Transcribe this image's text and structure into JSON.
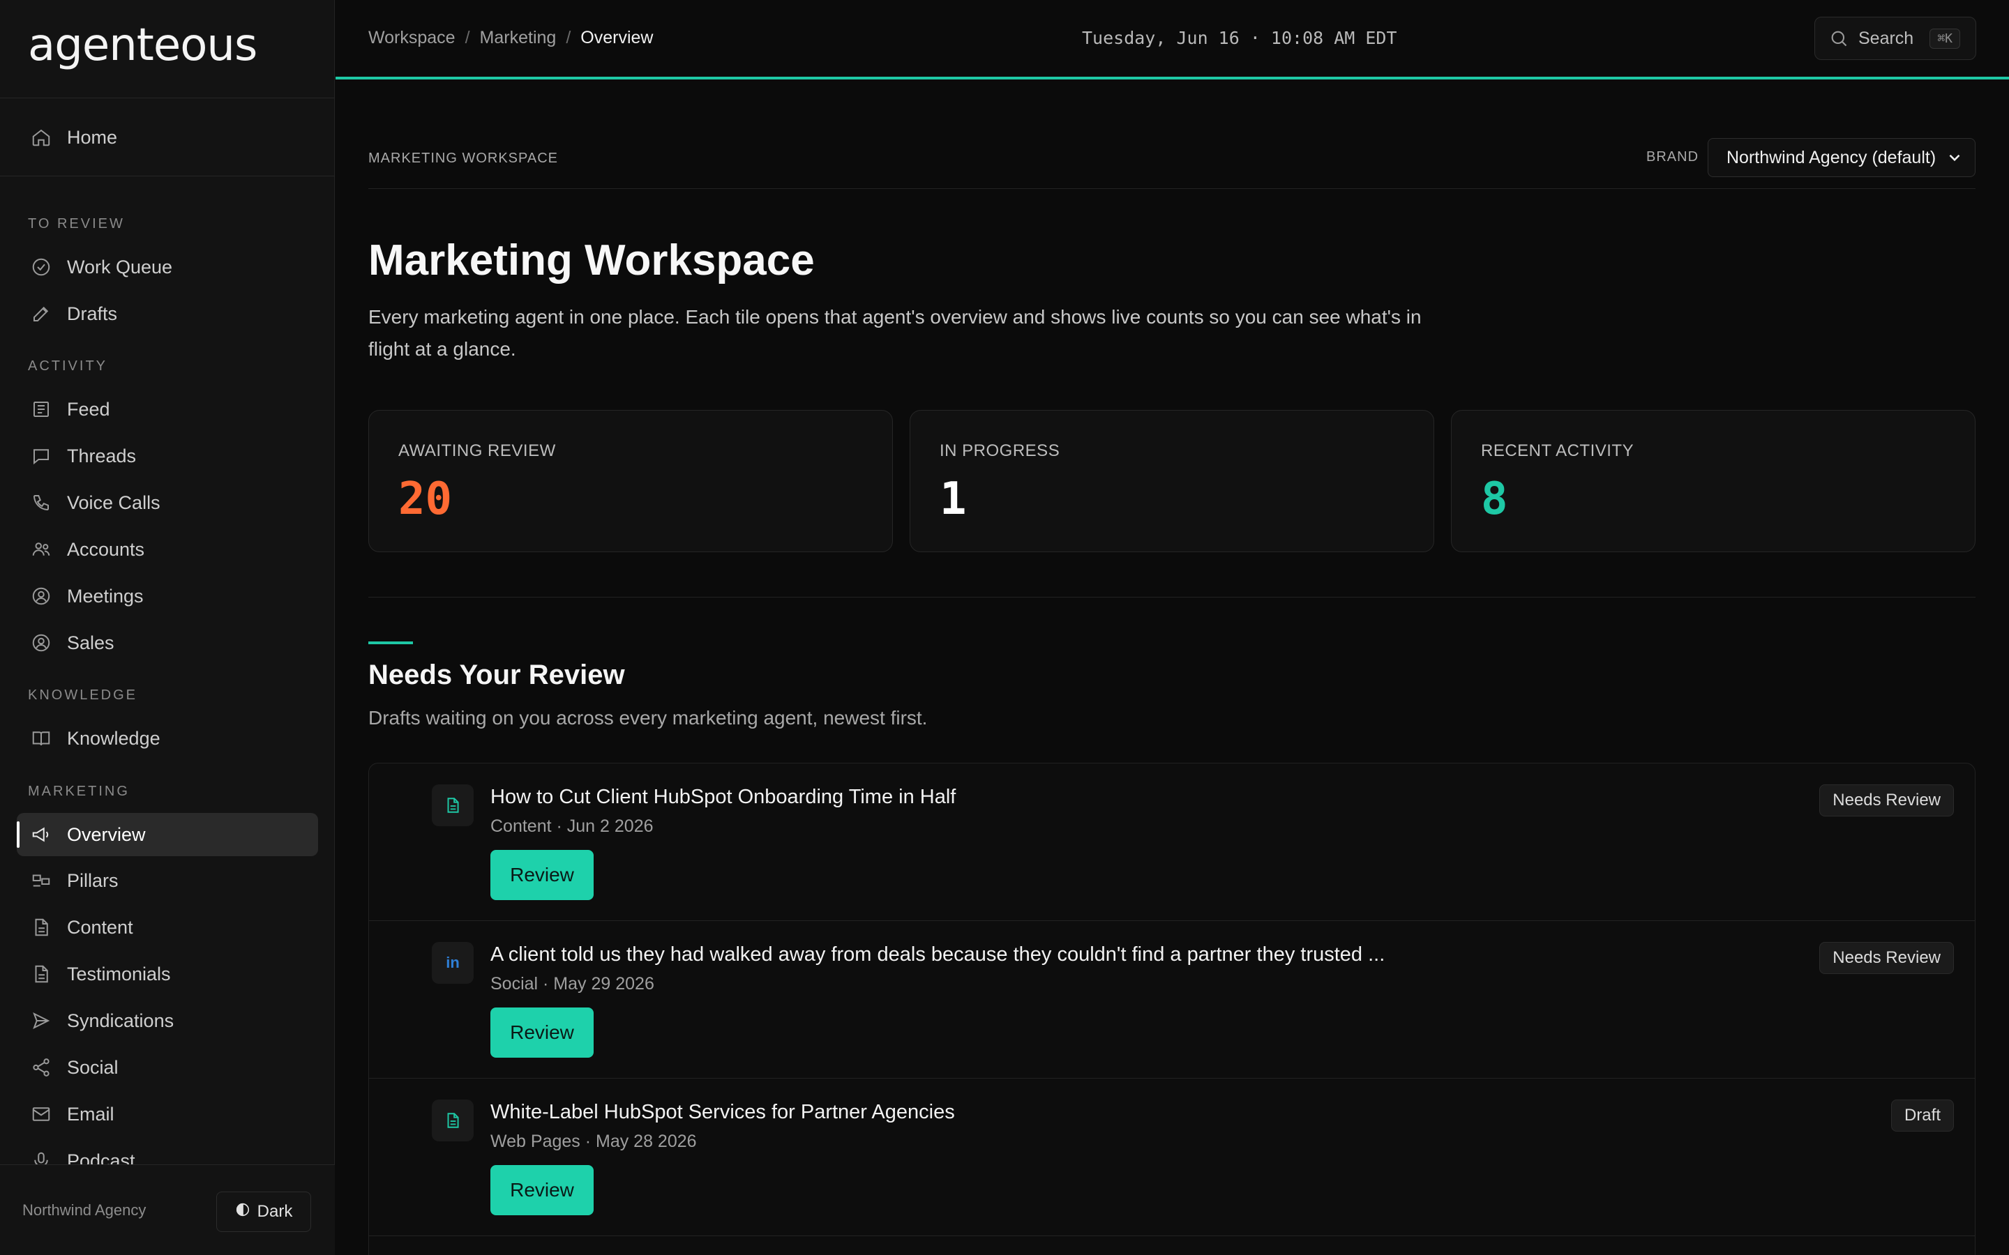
{
  "app": {
    "logo_text": "agenteous"
  },
  "sidebar": {
    "home": "Home",
    "sections": {
      "to_review": "TO REVIEW",
      "activity": "ACTIVITY",
      "knowledge": "KNOWLEDGE",
      "marketing": "MARKETING"
    },
    "to_review_items": [
      "Work Queue",
      "Drafts"
    ],
    "activity_items": [
      "Feed",
      "Threads",
      "Voice Calls",
      "Accounts",
      "Meetings",
      "Sales"
    ],
    "knowledge_items": [
      "Knowledge"
    ],
    "marketing_items": [
      "Overview",
      "Pillars",
      "Content",
      "Testimonials",
      "Syndications",
      "Social",
      "Email",
      "Podcast"
    ],
    "active_item": "Overview",
    "footer_org": "Northwind Agency",
    "theme_label": "Dark"
  },
  "topbar": {
    "breadcrumb": [
      "Workspace",
      "Marketing",
      "Overview"
    ],
    "datetime": "Tuesday, Jun 16 · 10:08 AM EDT",
    "search_label": "Search",
    "search_shortcut": "⌘K",
    "accent_color": "#1ec8a5"
  },
  "main": {
    "workspace_label": "MARKETING WORKSPACE",
    "brand_label": "BRAND",
    "brand_selected": "Northwind Agency (default)",
    "title": "Marketing Workspace",
    "description": "Every marketing agent in one place. Each tile opens that agent's overview and shows live counts so you can see what's in flight at a glance.",
    "stats": [
      {
        "label": "AWAITING REVIEW",
        "value": "20",
        "color": "#ff6a33"
      },
      {
        "label": "IN PROGRESS",
        "value": "1",
        "color": "#ffffff"
      },
      {
        "label": "RECENT ACTIVITY",
        "value": "8",
        "color": "#1ec8a5"
      }
    ],
    "review_section": {
      "title": "Needs Your Review",
      "description": "Drafts waiting on you across every marketing agent, newest first.",
      "items": [
        {
          "icon": "document-icon",
          "title": "How to Cut Client HubSpot Onboarding Time in Half",
          "meta": "Content · Jun 2 2026",
          "button": "Review",
          "badge": "Needs Review"
        },
        {
          "icon": "linkedin-icon",
          "icon_text": "in",
          "title": "A client told us they had walked away from deals because they couldn't find a partner they trusted ...",
          "meta": "Social · May 29 2026",
          "button": "Review",
          "badge": "Needs Review"
        },
        {
          "icon": "document-icon",
          "title": "White-Label HubSpot Services for Partner Agencies",
          "meta": "Web Pages · May 28 2026",
          "button": "Review",
          "badge": "Draft"
        }
      ]
    }
  }
}
